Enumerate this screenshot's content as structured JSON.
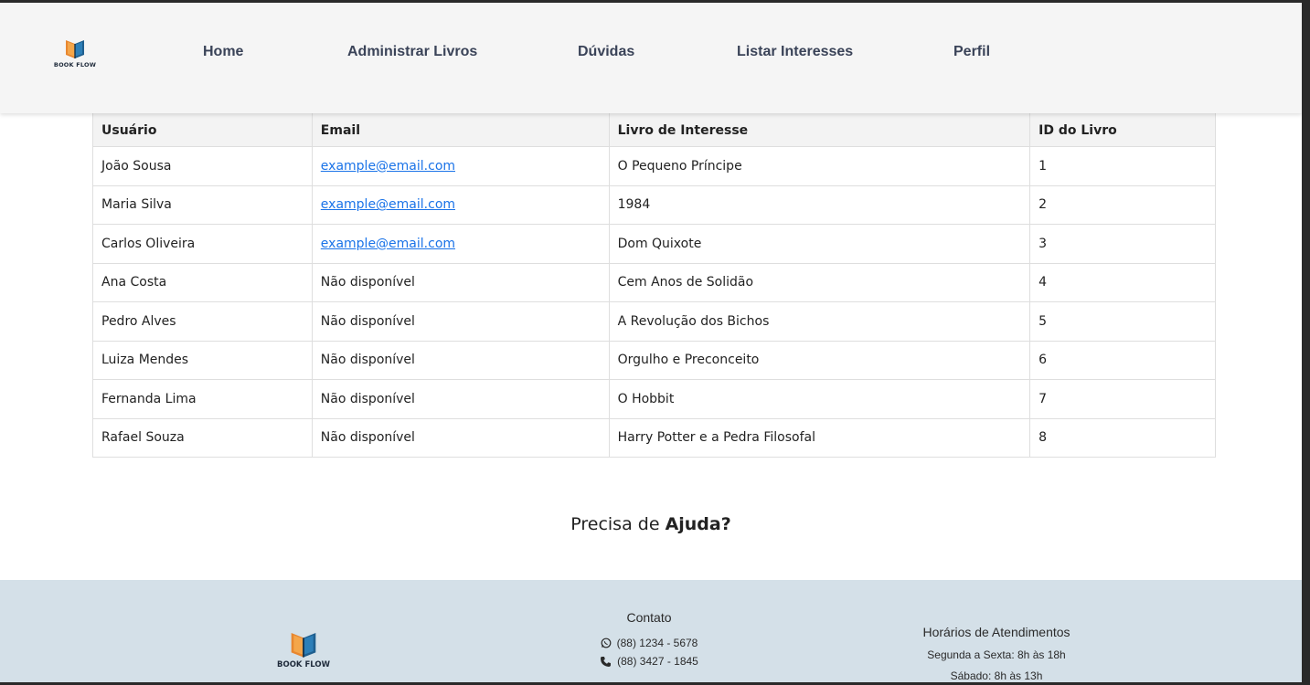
{
  "brand": {
    "name": "BOOK FLOW"
  },
  "nav": {
    "items": [
      {
        "label": "Home"
      },
      {
        "label": "Administrar Livros"
      },
      {
        "label": "Dúvidas"
      },
      {
        "label": "Listar Interesses"
      },
      {
        "label": "Perfil"
      }
    ]
  },
  "table": {
    "headers": [
      "Usuário",
      "Email",
      "Livro de Interesse",
      "ID do Livro"
    ],
    "rows": [
      {
        "user": "João Sousa",
        "email": "example@email.com",
        "book": "O Pequeno Príncipe",
        "id": "1"
      },
      {
        "user": "Maria Silva",
        "email": "example@email.com",
        "book": "1984",
        "id": "2"
      },
      {
        "user": "Carlos Oliveira",
        "email": "example@email.com",
        "book": "Dom Quixote",
        "id": "3"
      },
      {
        "user": "Ana Costa",
        "email": "Não disponível",
        "book": "Cem Anos de Solidão",
        "id": "4"
      },
      {
        "user": "Pedro Alves",
        "email": "Não disponível",
        "book": "A Revolução dos Bichos",
        "id": "5"
      },
      {
        "user": "Luiza Mendes",
        "email": "Não disponível",
        "book": "Orgulho e Preconceito",
        "id": "6"
      },
      {
        "user": "Fernanda Lima",
        "email": "Não disponível",
        "book": "O Hobbit",
        "id": "7"
      },
      {
        "user": "Rafael Souza",
        "email": "Não disponível",
        "book": "Harry Potter e a Pedra Filosofal",
        "id": "8"
      }
    ]
  },
  "help": {
    "prefix": "Precisa de",
    "emphasis": "Ajuda?"
  },
  "footer": {
    "contact": {
      "title": "Contato",
      "whatsapp": "(88) 1234 - 5678",
      "phone": "(88) 3427 - 1845"
    },
    "hours": {
      "title": "Horários de Atendimentos",
      "weekdays": "Segunda a Sexta: 8h às 18h",
      "saturday": "Sábado: 8h às 13h"
    }
  },
  "colors": {
    "header_bg": "#f5f5f5",
    "nav_text": "#3a4358",
    "link": "#1a73e8",
    "footer_bg": "#d4e0e8"
  }
}
